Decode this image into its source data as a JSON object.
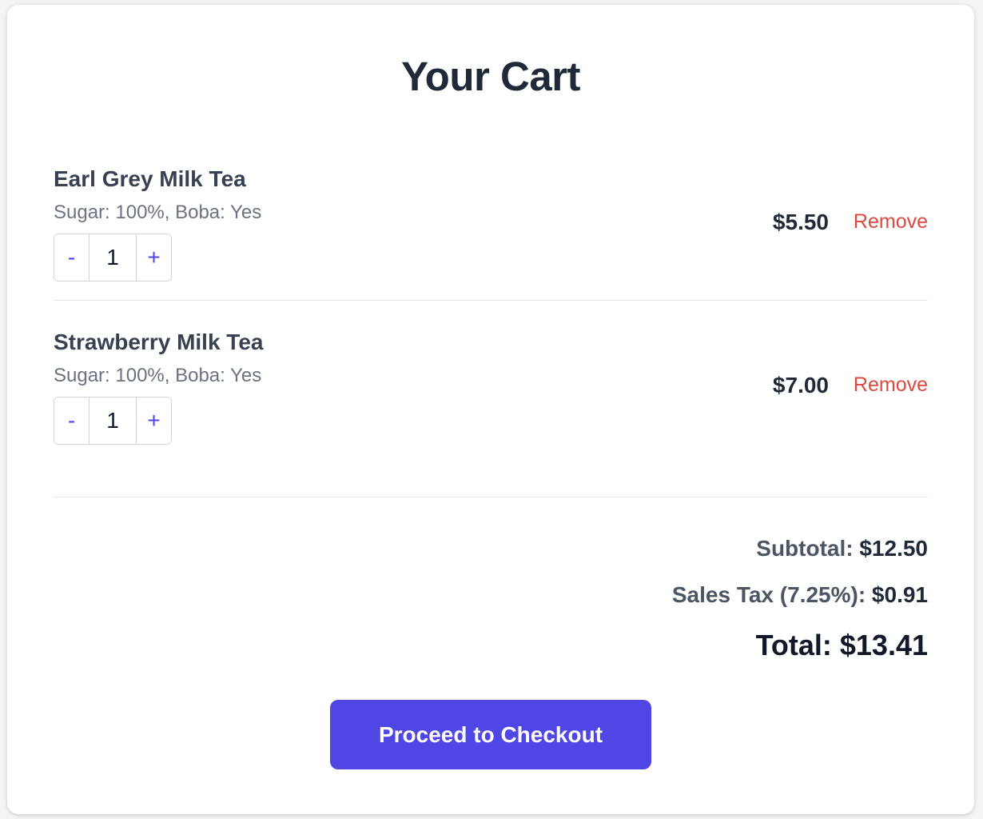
{
  "page": {
    "title": "Your Cart"
  },
  "cart": {
    "items": [
      {
        "name": "Earl Grey Milk Tea",
        "options": "Sugar: 100%, Boba: Yes",
        "quantity": "1",
        "price": "$5.50",
        "decrement_label": "-",
        "increment_label": "+",
        "remove_label": "Remove"
      },
      {
        "name": "Strawberry Milk Tea",
        "options": "Sugar: 100%, Boba: Yes",
        "quantity": "1",
        "price": "$7.00",
        "decrement_label": "-",
        "increment_label": "+",
        "remove_label": "Remove"
      }
    ]
  },
  "summary": {
    "subtotal_label": "Subtotal:",
    "subtotal_value": "$12.50",
    "tax_label": "Sales Tax (7.25%):",
    "tax_value": "$0.91",
    "total_label": "Total:",
    "total_value": "$13.41"
  },
  "checkout": {
    "label": "Proceed to Checkout"
  },
  "colors": {
    "accent": "#4f46e5",
    "remove": "#dc4a3e",
    "background": "#f3f4f6",
    "card": "#ffffff"
  }
}
